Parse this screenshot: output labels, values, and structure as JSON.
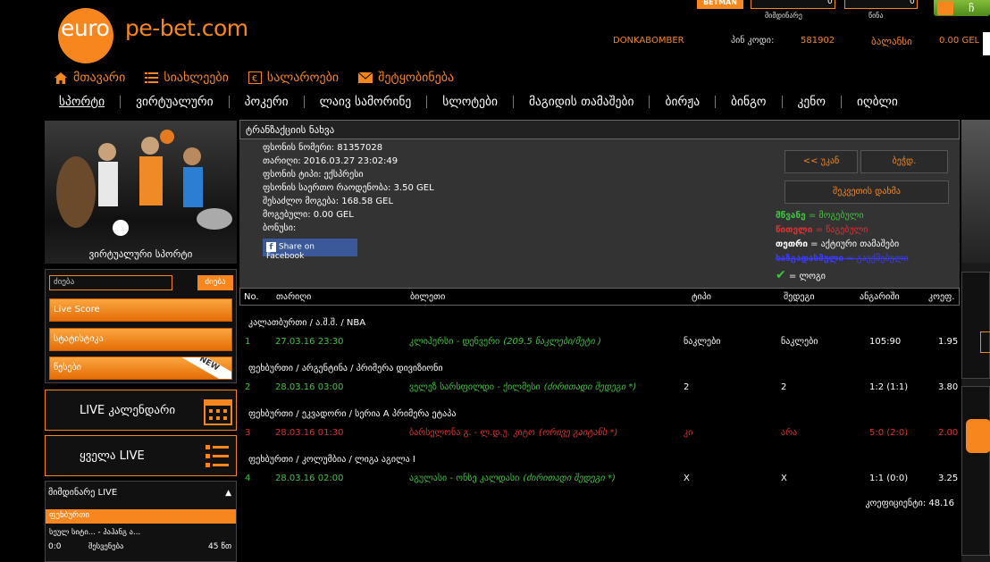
{
  "logo": {
    "part1": "euro",
    "part2": "pe-bet.com"
  },
  "top_widget": {
    "betman": "BETMAN",
    "current": "მიმდინარე",
    "week": "წინა",
    "val1": "0",
    "val2": "0",
    "corner": "ჩ"
  },
  "user": {
    "name": "DONKABOMBER",
    "pin_label": "პინ კოდი:",
    "pin": "581902",
    "balance_label": "ბალანსი",
    "balance": "0.00 GEL"
  },
  "topnav": [
    {
      "icon": "home-icon",
      "label": "მთავარი"
    },
    {
      "icon": "list-icon",
      "label": "სიახლეები"
    },
    {
      "icon": "cashier-icon",
      "label": "სალაროები"
    },
    {
      "icon": "mail-icon",
      "label": "შეტყობინება"
    }
  ],
  "mainnav": [
    "სპორტი",
    "ვირტუალური",
    "პოკერი",
    "ლაივ სამორინე",
    "სლოტები",
    "მაგიდის თამაშები",
    "ბირჟა",
    "ბინგო",
    "კენო",
    "იღბლი"
  ],
  "left": {
    "banner_caption": "ვირტუალური სპორტი",
    "search_placeholder": "ძიება",
    "search_button": "ძიება",
    "buttons": [
      "Live Score",
      "სტატისტიკა",
      "წესები"
    ],
    "new_badge": "NEW",
    "live_calendar": "LIVE კალენდარი",
    "all_live": "ყველა LIVE",
    "current_live": "მიმდინარე LIVE",
    "football": "ფეხბურთი",
    "match": {
      "teams": "სეულ სიტი... - პაჰანგ ა...",
      "score": "0:0",
      "half": "შესვენება",
      "minute": "45 წთ"
    }
  },
  "ticket": {
    "header": "ტრანზაქციის ნახვა",
    "lines": [
      "ფსონის ნომერი: 81357028",
      "თარიღი: 2016.03.27 23:02:49",
      "ფსონის ტიპი: ექსპრესი",
      "ფსონის საერთო რაოდენობა: 3.50 GEL",
      "შესაძლო მოგება: 168.58 GEL",
      "მოგებული: 0.00 GEL",
      "ბონუსი:"
    ],
    "facebook": "Share on Facebook",
    "back_button": "<< უკან",
    "print_button": "ბეჭდ.",
    "copy_button": "შეკვეთის დახმა",
    "legend": [
      {
        "label": "მწვანე",
        "text": "= მოგებული",
        "color": "#3ec43e"
      },
      {
        "label": "წითელი",
        "text": "= წაგებული",
        "color": "#e03030"
      },
      {
        "label": "თეთრი",
        "text": "= აქტიური თამაშები",
        "color": "#ffffff"
      },
      {
        "label": "ხაზგადასმული",
        "text": "= გაუქმებული",
        "color": "#3a3aff"
      }
    ],
    "win_legend": "= ლოგი",
    "columns": [
      "No.",
      "თარიღი",
      "ბილეთი",
      "ტიპი",
      "შედეგი",
      "ანგარიში",
      "კოეფ."
    ],
    "groups": [
      {
        "title": "კალათბურთი / ა.შ.შ. / NBA",
        "row": {
          "no": "1",
          "date": "27.03.16 23:30",
          "match": "კლიპერსი - დენვერი",
          "detail": "(209.5 ნაკლები/მეტი )",
          "type": "ნაკლები",
          "result": "ნაკლები",
          "score": "105:90",
          "odd": "1.95",
          "status": "won"
        }
      },
      {
        "title": "ფეხბურთი / არგენტინა / პრიმერა დივიზიონი",
        "row": {
          "no": "2",
          "date": "28.03.16 03:00",
          "match": "ველეზ სარსფილდი - ქილმესი",
          "detail": "(ძირითადი შედეგი *)",
          "type": "2",
          "result": "2",
          "score": "1:2 (1:1)",
          "odd": "3.80",
          "status": "won"
        }
      },
      {
        "title": "ფეხბურთი / ეკვადორი / სერია A პრიმერა ეტაპა",
        "row": {
          "no": "3",
          "date": "28.03.16 01:30",
          "match": "ბარსელონა გ. - ლ.დ.უ. კიტო",
          "detail": "(ორივე გაიტანს *)",
          "type": "კი",
          "result": "არა",
          "score": "5:0 (2:0)",
          "odd": "2.00",
          "status": "lost"
        }
      },
      {
        "title": "ფეხბურთი / კოლუმბია / ლიგა აგილა I",
        "row": {
          "no": "4",
          "date": "28.03.16 02:00",
          "match": "აგულასი - ონსე კალდასი",
          "detail": "(ძირითადი შედეგი *)",
          "type": "X",
          "result": "X",
          "score": "1:1 (0:0)",
          "odd": "3.25",
          "status": "won"
        }
      }
    ],
    "total_label": "კოეფიციენტი: 48.16"
  },
  "colors": {
    "accent": "#f7861e",
    "won": "#3ec43e",
    "lost": "#e03030"
  }
}
